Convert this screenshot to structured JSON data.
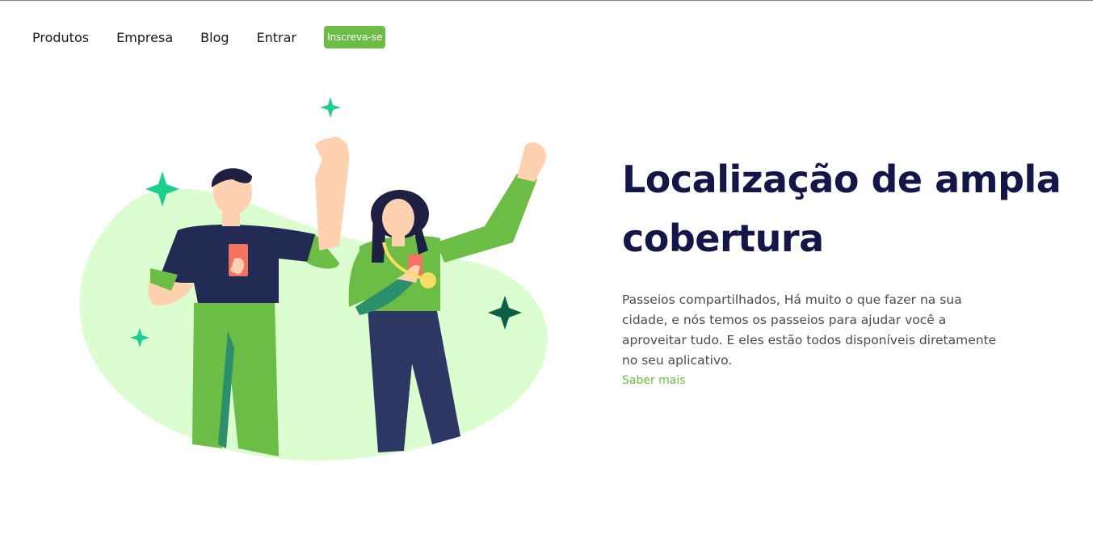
{
  "nav": {
    "links": [
      {
        "label": "Produtos"
      },
      {
        "label": "Empresa"
      },
      {
        "label": "Blog"
      },
      {
        "label": "Entrar"
      }
    ],
    "signup_label": "Inscreva-se"
  },
  "hero": {
    "title": "Localização de ampla cobertura",
    "description": "Passeios compartilhados, Há muito o que fazer na sua cidade, e nós temos os passeios para ajudar você a aproveitar tudo. E eles estão todos disponíveis diretamente no seu aplicativo.",
    "more_link": "Saber mais"
  },
  "colors": {
    "accent": "#6cbd45",
    "title": "#14164a",
    "blob": "#dcfdd0",
    "navy": "#232b55",
    "sparkle": "#1ccf8f",
    "sparkle_dark": "#0b5e4a"
  }
}
